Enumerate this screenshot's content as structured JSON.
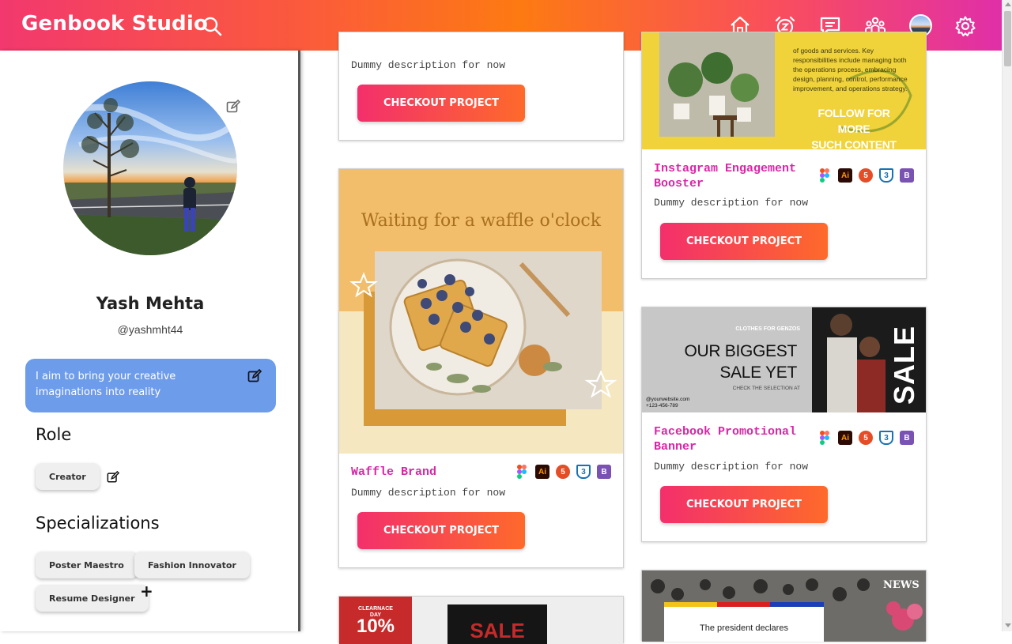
{
  "header": {
    "brand": "Genbook Studio",
    "icons": [
      "search-icon",
      "home-icon",
      "alarm-icon",
      "chat-icon",
      "community-icon",
      "profile-avatar",
      "settings-icon"
    ]
  },
  "profile": {
    "name": "Yash Mehta",
    "handle": "@yashmht44",
    "bio": "I aim to bring your creative imaginations into reality",
    "role_title": "Role",
    "role": "Creator",
    "specializations_title": "Specializations",
    "specializations": [
      "Poster Maestro",
      "Fashion Innovator",
      "Resume Designer"
    ],
    "add_label": "+"
  },
  "projects": {
    "cta_label": "CHECKOUT PROJECT",
    "tools": [
      "figma-icon",
      "illustrator-icon",
      "html5-icon",
      "css3-icon",
      "bootstrap-icon"
    ],
    "items": [
      {
        "title": "",
        "desc": "Dummy description for now"
      },
      {
        "title": "Waffle Brand",
        "desc": "Dummy description for now",
        "image_text": "Waiting for a waffle o'clock"
      },
      {
        "title": "Instagram Engagement Booster",
        "desc": "Dummy description for now",
        "image_text": [
          "of goods and services. Key",
          "responsibilities include managing both",
          "the operations process, embracing",
          "design, planning, control, performance",
          "improvement, and operations strategy.",
          "FOLLOW FOR MORE",
          "SUCH CONTENT"
        ]
      },
      {
        "title": "Facebook Promotional Banner",
        "desc": "Dummy description for now",
        "image_text": {
          "kicker": "CLOTHES FOR GENZOS",
          "headline1": "OUR BIGGEST",
          "headline2": "SALE YET",
          "sub": "CHECK THE SELECTION AT",
          "site": "@yourwebsite.com",
          "phone": "+123-456-789",
          "side": "SALE"
        }
      },
      {
        "image_text": {
          "badge1": "CLEARNACE",
          "badge2": "DAY",
          "pct": "10%",
          "sale": "SALE"
        }
      },
      {
        "image_text": {
          "news": "NEWS",
          "line": "The president declares"
        }
      }
    ]
  }
}
